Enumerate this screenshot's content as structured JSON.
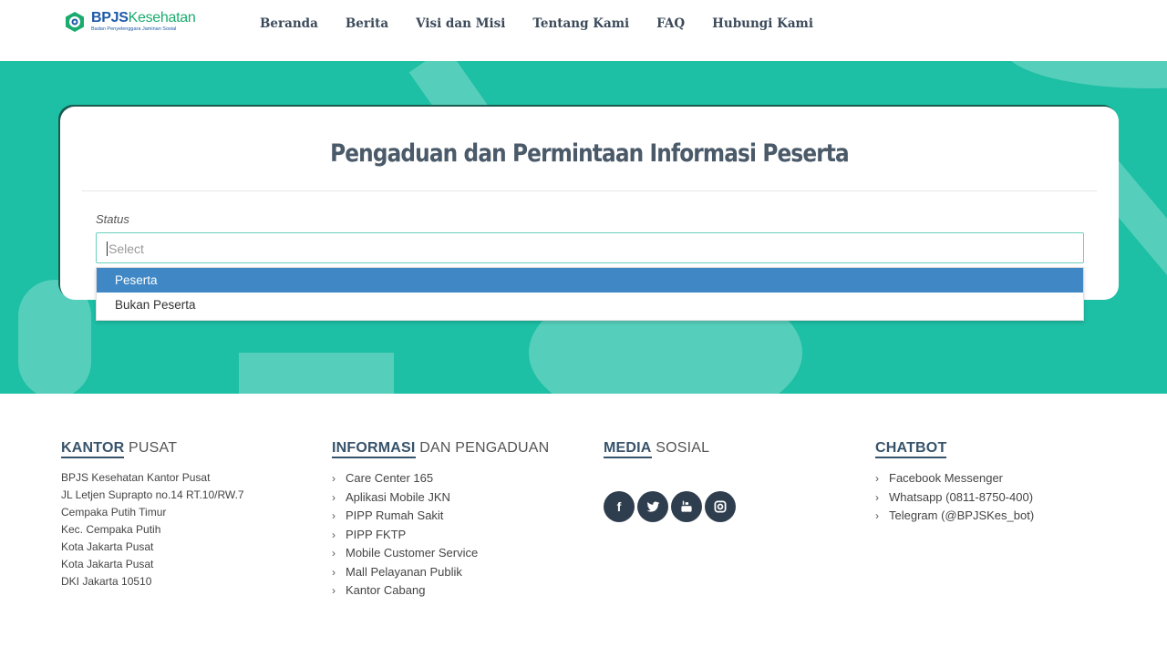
{
  "brand": {
    "name_part1": "BPJS",
    "name_part2": "Kesehatan",
    "subtitle": "Badan Penyelenggara Jaminan Sosial"
  },
  "nav": [
    "Beranda",
    "Berita",
    "Visi dan Misi",
    "Tentang Kami",
    "FAQ",
    "Hubungi Kami"
  ],
  "form": {
    "title": "Pengaduan dan Permintaan Informasi Peserta",
    "status_label": "Status",
    "status_placeholder": "Select",
    "options": [
      "Peserta",
      "Bukan Peserta"
    ],
    "highlighted_option": "Peserta"
  },
  "footer": {
    "kantor": {
      "title_bold": "KANTOR",
      "title_rest": "PUSAT",
      "address": [
        "BPJS Kesehatan Kantor Pusat",
        "JL Letjen Suprapto no.14 RT.10/RW.7",
        "Cempaka Putih Timur",
        "Kec. Cempaka Putih",
        "Kota Jakarta Pusat",
        "Kota Jakarta Pusat",
        "DKI Jakarta 10510"
      ]
    },
    "informasi": {
      "title_bold": "INFORMASI",
      "title_rest": "DAN PENGADUAN",
      "links": [
        "Care Center 165",
        "Aplikasi Mobile JKN",
        "PIPP Rumah Sakit",
        "PIPP FKTP",
        "Mobile Customer Service",
        "Mall Pelayanan Publik",
        "Kantor Cabang"
      ]
    },
    "media": {
      "title_bold": "MEDIA",
      "title_rest": "SOSIAL",
      "icons": [
        "facebook-icon",
        "twitter-icon",
        "youtube-icon",
        "instagram-icon"
      ]
    },
    "chatbot": {
      "title_bold": "CHATBOT",
      "links": [
        "Facebook Messenger",
        "Whatsapp (0811-8750-400)",
        "Telegram (@BPJSKes_bot)"
      ]
    }
  },
  "colors": {
    "hero": "#1dbfa5",
    "nav_text": "#3b4a5a",
    "option_highlight": "#3f88c5",
    "social_bg": "#2f3e4e"
  }
}
